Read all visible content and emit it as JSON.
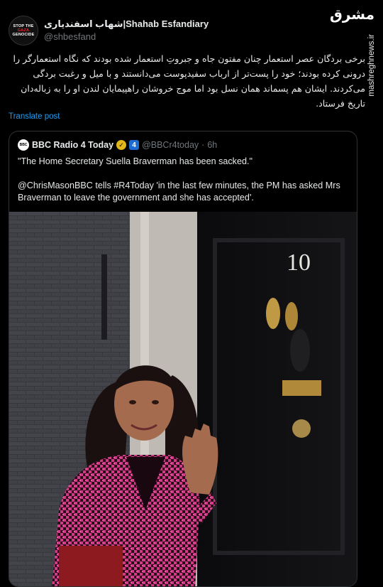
{
  "author": {
    "avatar_text": [
      "STOP THE",
      "GAZA",
      "GENOCIDE"
    ],
    "name": "شهاب اسفندیاری|Shahab Esfandiary",
    "handle": "@shbesfand"
  },
  "brand": {
    "logo": "مشرق",
    "site": "mashreghnews.ir"
  },
  "tweet": {
    "text": "برخی بردگان عصر استعمار چنان مفتون جاه و جبروتِ استعمار شده بودند که نگاه استعمارگر را درونی کرده بودند؛ خود را پست‌تر از ارباب سفیدپوست می‌دانستند و با میل و رغبت بردگی می‌کردند. ایشان هم پسماند همان نسل بود اما موج خروشان راهپیمایان لندن او را به زباله‌دان تاریخ فرستاد.",
    "translate_label": "Translate post"
  },
  "quoted": {
    "avatar_text": "BBC",
    "name": "BBC Radio 4 Today",
    "badge_number": "4",
    "handle": "@BBCr4today",
    "separator": "·",
    "time": "6h",
    "line1": "\"The Home Secretary Suella Braverman has been sacked.\"",
    "line2": "@ChrisMasonBBC tells #R4Today 'in the last few minutes, the PM has asked Mrs Braverman to leave the government and she has accepted'.",
    "photo": {
      "door_number": "10"
    }
  },
  "colors": {
    "background": "#000000",
    "text": "#e7e9ea",
    "muted": "#71767b",
    "link": "#1d9bf0",
    "border": "#2f3336",
    "verified_gold": "#e2b719",
    "coat_pink": "#d13b86"
  }
}
